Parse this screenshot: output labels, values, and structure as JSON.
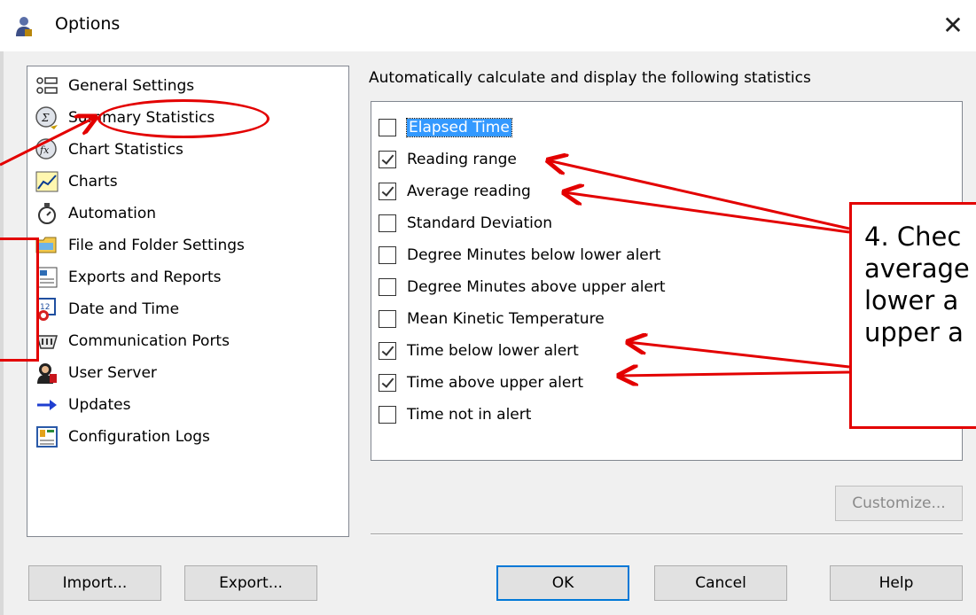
{
  "window": {
    "title": "Options",
    "close_glyph": "✕"
  },
  "nav": {
    "items": [
      {
        "label": "General Settings",
        "icon": "list-settings-icon"
      },
      {
        "label": "Summary Statistics",
        "icon": "sum-stat-icon"
      },
      {
        "label": "Chart Statistics",
        "icon": "chart-stat-icon"
      },
      {
        "label": "Charts",
        "icon": "chart-line-icon"
      },
      {
        "label": "Automation",
        "icon": "stopwatch-icon"
      },
      {
        "label": "File and Folder Settings",
        "icon": "folder-icon"
      },
      {
        "label": "Exports and Reports",
        "icon": "report-icon"
      },
      {
        "label": "Date and Time",
        "icon": "calendar-clock-icon"
      },
      {
        "label": "Communication Ports",
        "icon": "ports-icon"
      },
      {
        "label": "User Server",
        "icon": "user-server-icon"
      },
      {
        "label": "Updates",
        "icon": "arrow-right-icon"
      },
      {
        "label": "Configuration Logs",
        "icon": "config-log-icon"
      }
    ]
  },
  "stats": {
    "header": "Automatically calculate and display the following statistics",
    "items": [
      {
        "label": "Elapsed Time",
        "checked": false
      },
      {
        "label": "Reading range",
        "checked": true
      },
      {
        "label": "Average reading",
        "checked": true
      },
      {
        "label": "Standard Deviation",
        "checked": false
      },
      {
        "label": "Degree Minutes below lower alert",
        "checked": false
      },
      {
        "label": "Degree Minutes above upper alert",
        "checked": false
      },
      {
        "label": "Mean Kinetic Temperature",
        "checked": false
      },
      {
        "label": "Time below lower alert",
        "checked": true
      },
      {
        "label": "Time above upper alert",
        "checked": true
      },
      {
        "label": "Time not in alert",
        "checked": false
      }
    ]
  },
  "buttons": {
    "customize": "Customize...",
    "import": "Import...",
    "export": "Export...",
    "ok": "OK",
    "cancel": "Cancel",
    "help": "Help"
  },
  "annotation": {
    "callout_lines": [
      "4. Chec",
      "average",
      "lower a",
      "upper a"
    ],
    "color": "#e30000"
  }
}
